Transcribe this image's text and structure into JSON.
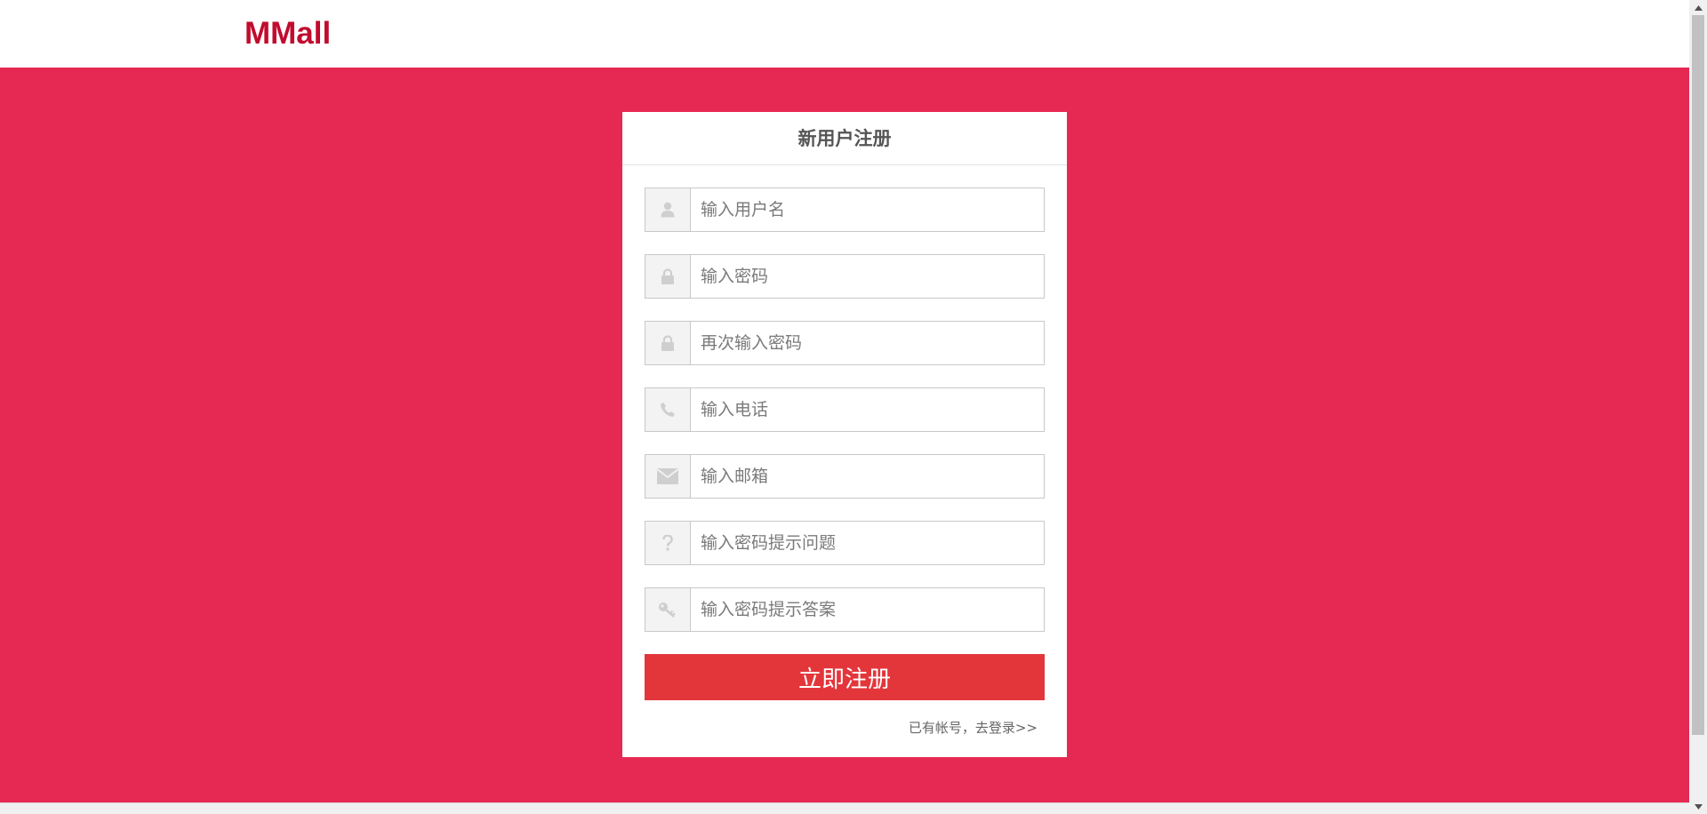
{
  "header": {
    "logo": "MMall"
  },
  "register": {
    "title": "新用户注册",
    "fields": [
      {
        "icon": "user-icon",
        "placeholder": "输入用户名"
      },
      {
        "icon": "lock-icon",
        "placeholder": "输入密码"
      },
      {
        "icon": "lock-icon",
        "placeholder": "再次输入密码"
      },
      {
        "icon": "phone-icon",
        "placeholder": "输入电话"
      },
      {
        "icon": "envelope-icon",
        "placeholder": "输入邮箱"
      },
      {
        "icon": "question-icon",
        "placeholder": "输入密码提示问题"
      },
      {
        "icon": "key-icon",
        "placeholder": "输入密码提示答案"
      }
    ],
    "submit_label": "立即注册",
    "login_link": "已有帐号，去登录>>"
  },
  "colors": {
    "brand": "#c10c2e",
    "banner": "#e62953",
    "button": "#e3363b"
  }
}
